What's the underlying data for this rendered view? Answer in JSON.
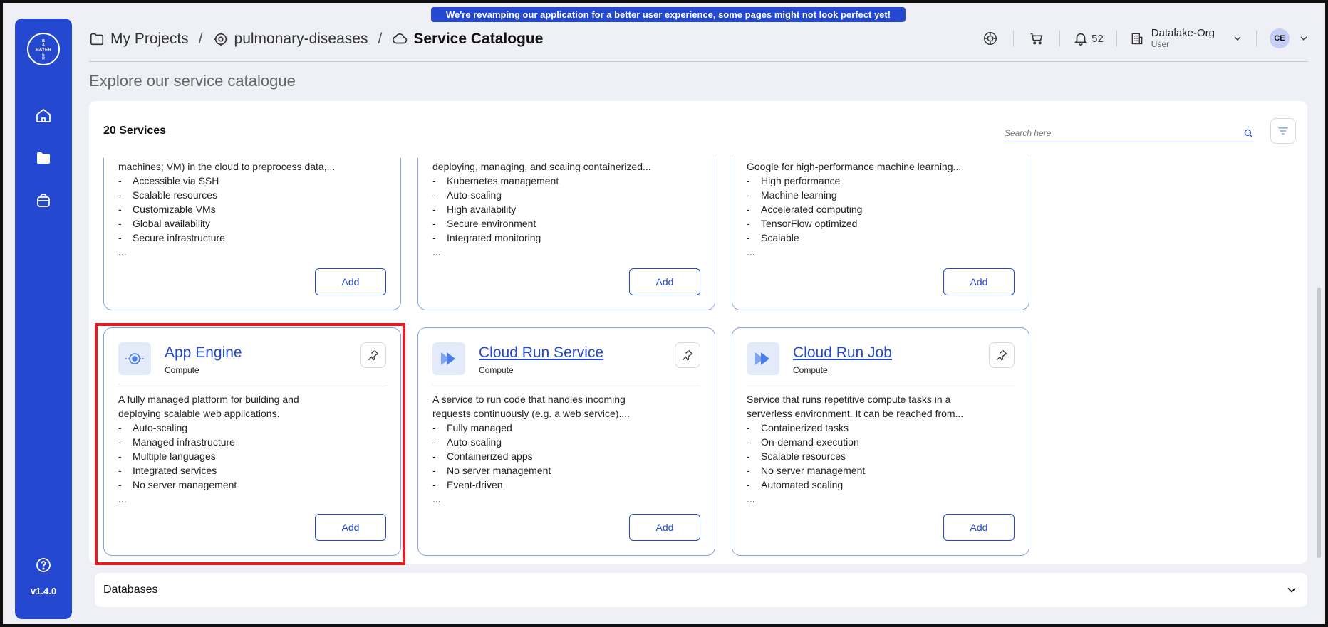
{
  "banner": {
    "text": "We're revamping our application for a better user experience, some pages might not look perfect yet!"
  },
  "sidebar": {
    "version": "v1.4.0"
  },
  "breadcrumb": {
    "my_projects": "My Projects",
    "project": "pulmonary-diseases",
    "current": "Service Catalogue"
  },
  "header": {
    "notification_count": "52",
    "org_name": "Datalake-Org",
    "org_role": "User",
    "avatar_initials": "CE"
  },
  "page": {
    "title": "Explore our service catalogue"
  },
  "catalogue": {
    "count_label": "20 Services",
    "search_placeholder": "Search here",
    "top_cards": [
      {
        "desc_line": "machines; VM) in the cloud to preprocess data,...",
        "features": [
          "Accessible via SSH",
          "Scalable resources",
          "Customizable VMs",
          "Global availability",
          "Secure infrastructure"
        ],
        "ellipsis": "...",
        "add_label": "Add"
      },
      {
        "desc_line": "deploying, managing, and scaling containerized...",
        "features": [
          "Kubernetes management",
          "Auto-scaling",
          "High availability",
          "Secure environment",
          "Integrated monitoring"
        ],
        "ellipsis": "...",
        "add_label": "Add"
      },
      {
        "desc_line": "Google for high-performance machine learning...",
        "features": [
          "High performance",
          "Machine learning",
          "Accelerated computing",
          "TensorFlow optimized",
          "Scalable"
        ],
        "ellipsis": "...",
        "add_label": "Add"
      }
    ],
    "bottom_cards": [
      {
        "title": "App Engine",
        "category": "Compute",
        "desc": [
          "A fully managed platform for building and",
          "deploying scalable web applications."
        ],
        "features": [
          "Auto-scaling",
          "Managed infrastructure",
          "Multiple languages",
          "Integrated services",
          "No server management"
        ],
        "ellipsis": "...",
        "add_label": "Add",
        "icon": "app-engine-icon"
      },
      {
        "title": "Cloud Run Service",
        "category": "Compute",
        "desc": [
          "A service to run code that handles incoming",
          "requests continuously (e.g. a web service)...."
        ],
        "features": [
          "Fully managed",
          "Auto-scaling",
          "Containerized apps",
          "No server management",
          "Event-driven"
        ],
        "ellipsis": "...",
        "add_label": "Add",
        "icon": "cloud-run-icon"
      },
      {
        "title": "Cloud Run Job",
        "category": "Compute",
        "desc": [
          "Service that runs repetitive compute tasks in a",
          "serverless environment. It can be reached from..."
        ],
        "features": [
          "Containerized tasks",
          "On-demand execution",
          "Scalable resources",
          "No server management",
          "Automated scaling"
        ],
        "ellipsis": "...",
        "add_label": "Add",
        "icon": "cloud-run-icon"
      }
    ]
  },
  "accordion": {
    "databases_label": "Databases"
  },
  "colors": {
    "brand": "#2448cf",
    "highlight": "#e31b23"
  }
}
